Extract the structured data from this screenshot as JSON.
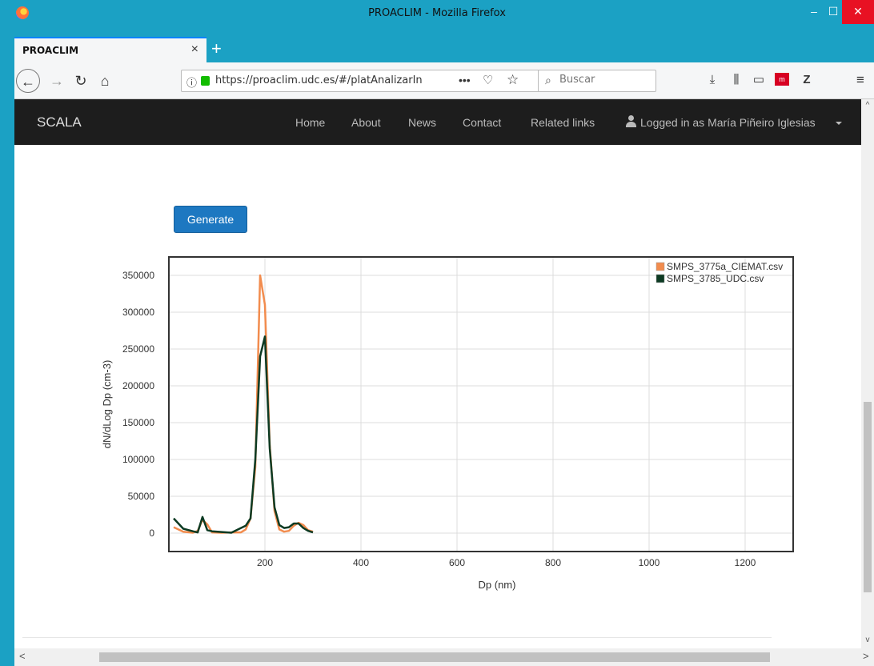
{
  "window": {
    "title": "PROACLIM - Mozilla Firefox",
    "min_label": "–",
    "max_label": "☐",
    "close_label": "✕"
  },
  "tab": {
    "title": "PROACLIM",
    "close_label": "×",
    "new_tab_label": "+"
  },
  "toolbar": {
    "url": "https://proaclim.udc.es/#/platAnalizarIn",
    "search_placeholder": "Buscar",
    "icons": [
      "back-icon",
      "forward-icon",
      "reload-icon",
      "home-icon",
      "info-icon",
      "lock-icon",
      "page-actions-icon",
      "pocket-icon",
      "bookmark-star-icon",
      "search-icon",
      "download-icon",
      "library-icon",
      "sidebar-icon",
      "addon-icon",
      "zotero-icon",
      "menu-icon"
    ]
  },
  "site": {
    "brand": "SCALA",
    "nav": [
      "Home",
      "About",
      "News",
      "Contact",
      "Related links"
    ],
    "user": "Logged in as María Piñeiro Iglesias"
  },
  "generate_label": "Generate",
  "chart_data": {
    "type": "line",
    "xlabel": "Dp (nm)",
    "ylabel": "dN/dLog Dp (cm-3)",
    "x_ticks": [
      200,
      400,
      600,
      800,
      1000,
      1200
    ],
    "y_ticks": [
      0,
      50000,
      100000,
      150000,
      200000,
      250000,
      300000,
      350000
    ],
    "xlim": [
      0,
      1300
    ],
    "ylim": [
      -25000,
      375000
    ],
    "grid": true,
    "legend_position": "top-right",
    "series": [
      {
        "name": "SMPS_3775a_CIEMAT.csv",
        "color": "#f28c4e",
        "x": [
          10,
          30,
          50,
          60,
          70,
          80,
          90,
          110,
          130,
          150,
          160,
          170,
          180,
          190,
          200,
          210,
          220,
          230,
          240,
          250,
          260,
          270,
          280,
          290,
          300
        ],
        "y": [
          8000,
          2000,
          500,
          3000,
          18000,
          12000,
          1000,
          500,
          1000,
          1000,
          5000,
          20000,
          90000,
          350000,
          310000,
          120000,
          30000,
          5000,
          2000,
          3000,
          10000,
          14000,
          11000,
          4000,
          2000
        ]
      },
      {
        "name": "SMPS_3785_UDC.csv",
        "color": "#0c3a22",
        "x": [
          10,
          30,
          50,
          60,
          70,
          80,
          90,
          110,
          130,
          150,
          160,
          170,
          180,
          190,
          200,
          210,
          220,
          230,
          240,
          250,
          260,
          270,
          280,
          290,
          300
        ],
        "y": [
          20000,
          6000,
          2500,
          1000,
          22000,
          4000,
          2500,
          1500,
          500,
          7000,
          10000,
          20000,
          100000,
          240000,
          267000,
          115000,
          35000,
          11000,
          7000,
          8000,
          13000,
          13000,
          7000,
          3000,
          1000
        ]
      }
    ]
  }
}
